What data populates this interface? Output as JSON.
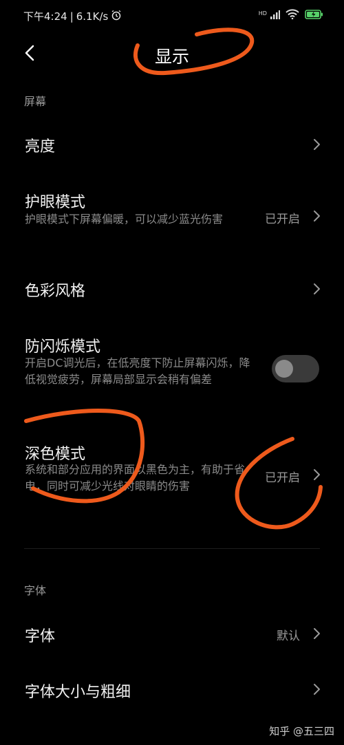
{
  "status": {
    "time": "下午4:24",
    "speed": "6.1K/s",
    "hd": "HD"
  },
  "header": {
    "title": "显示"
  },
  "sections": {
    "screen": "屏幕",
    "font": "字体"
  },
  "rows": {
    "brightness": {
      "title": "亮度"
    },
    "eye_care": {
      "title": "护眼模式",
      "subtitle": "护眼模式下屏幕偏暖，可以减少蓝光伤害",
      "value": "已开启"
    },
    "color_style": {
      "title": "色彩风格"
    },
    "anti_flicker": {
      "title": "防闪烁模式",
      "subtitle": "开启DC调光后，在低亮度下防止屏幕闪烁，降低视觉疲劳，屏幕局部显示会稍有偏差",
      "enabled": false
    },
    "dark_mode": {
      "title": "深色模式",
      "subtitle": "系统和部分应用的界面以黑色为主，有助于省电，同时可减少光线对眼睛的伤害",
      "value": "已开启"
    },
    "font": {
      "title": "字体",
      "value": "默认"
    },
    "font_size": {
      "title": "字体大小与粗细"
    }
  },
  "watermark": "知乎 @五三四",
  "colors": {
    "annotation": "#ee5a1c",
    "background": "#000000",
    "battery": "#58d36a"
  }
}
